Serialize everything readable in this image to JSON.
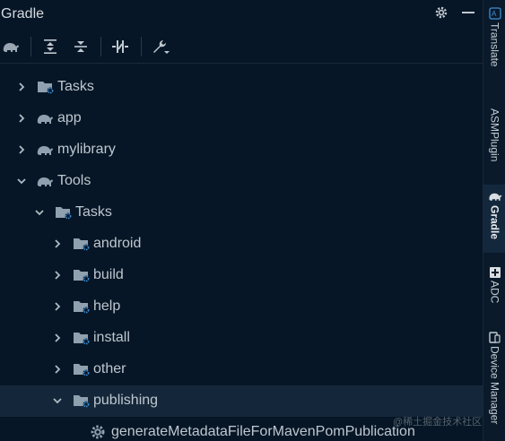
{
  "panel": {
    "title": "Gradle"
  },
  "toolbar": {
    "buttons": [
      "gradle-elephant",
      "expand-all",
      "collapse-all",
      "toggle-offline",
      "build-tool-settings"
    ]
  },
  "tree": [
    {
      "label": "Tasks",
      "icon": "task-folder-icon",
      "expanded": false
    },
    {
      "label": "app",
      "icon": "gradle-elephant-icon",
      "expanded": false
    },
    {
      "label": "mylibrary",
      "icon": "gradle-elephant-icon",
      "expanded": false
    },
    {
      "label": "Tools",
      "icon": "gradle-elephant-icon",
      "expanded": true
    },
    {
      "label": "Tasks",
      "icon": "task-folder-icon",
      "expanded": true
    },
    {
      "label": "android",
      "icon": "task-folder-icon",
      "expanded": false
    },
    {
      "label": "build",
      "icon": "task-folder-icon",
      "expanded": false
    },
    {
      "label": "help",
      "icon": "task-folder-icon",
      "expanded": false
    },
    {
      "label": "install",
      "icon": "task-folder-icon",
      "expanded": false
    },
    {
      "label": "other",
      "icon": "task-folder-icon",
      "expanded": false
    },
    {
      "label": "publishing",
      "icon": "task-folder-icon",
      "expanded": true,
      "selected": true
    },
    {
      "label": "generateMetadataFileForMavenPomPublication",
      "icon": "gear-icon"
    }
  ],
  "sidebar": {
    "tabs": [
      {
        "label": "Translate",
        "icon": "translate-icon"
      },
      {
        "label": "ASMPlugin"
      },
      {
        "label": "Gradle",
        "icon": "gradle-elephant-icon",
        "active": true
      },
      {
        "label": "ADC",
        "icon": "plus-box-icon"
      },
      {
        "label": "Device Manager",
        "icon": "device-icon"
      }
    ]
  },
  "watermark": "@稀土掘金技术社区",
  "colors": {
    "background": "#061626",
    "selection": "#14273a",
    "accent": "#3d8fd6",
    "icon": "#8fa0ae"
  }
}
